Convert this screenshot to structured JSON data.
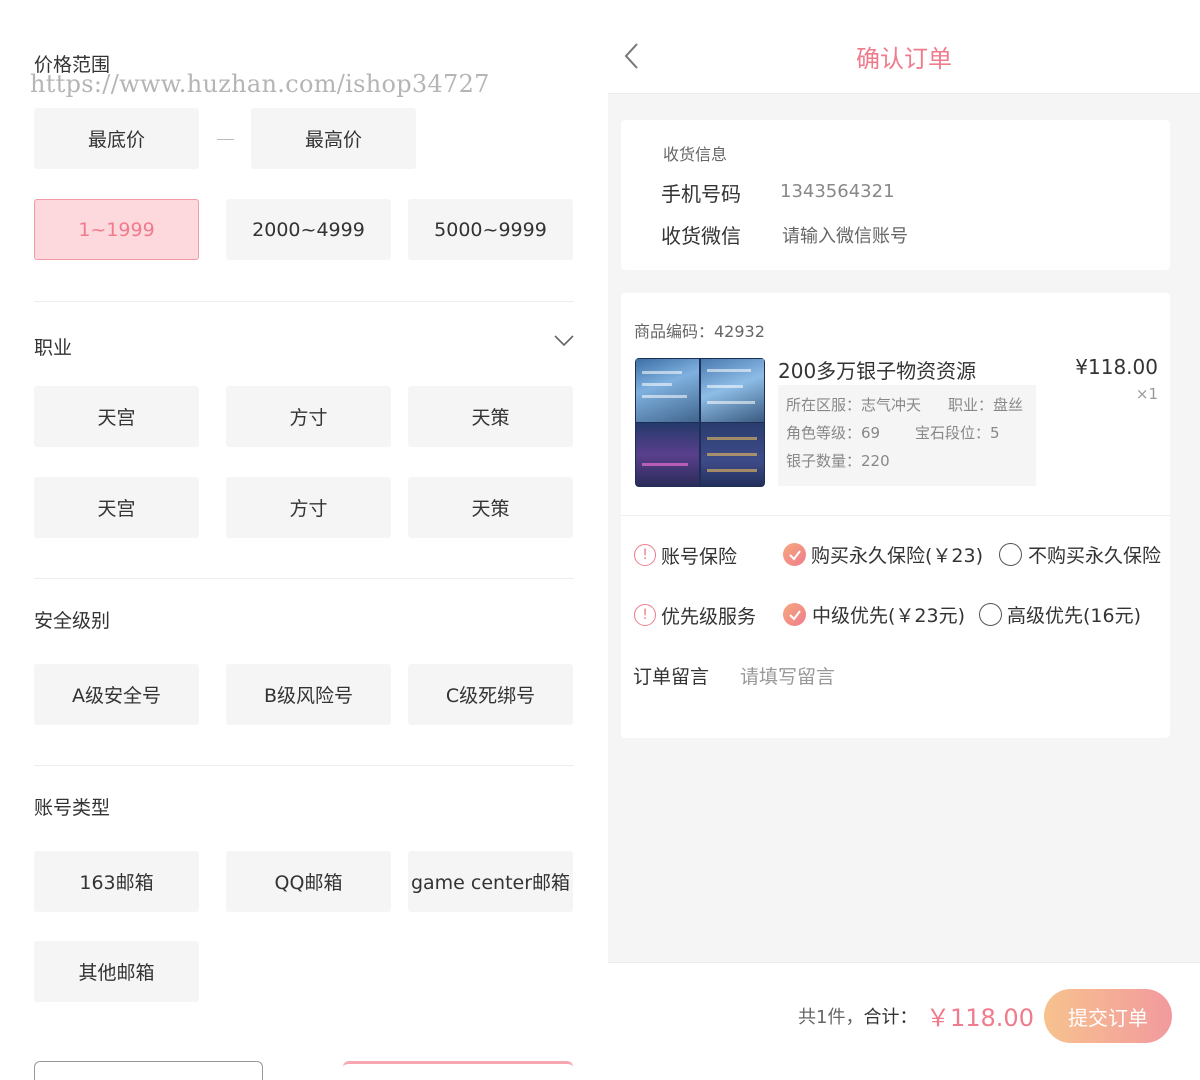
{
  "watermark": "https://www.huzhan.com/ishop34727",
  "filter": {
    "price": {
      "title": "价格范围",
      "min_placeholder": "最底价",
      "max_placeholder": "最高价",
      "ranges": [
        "1~1999",
        "2000~4999",
        "5000~9999"
      ],
      "selected": "1~1999"
    },
    "profession": {
      "title": "职业",
      "options": [
        "天宫",
        "方寸",
        "天策",
        "天宫",
        "方寸",
        "天策"
      ]
    },
    "security": {
      "title": "安全级别",
      "options": [
        "A级安全号",
        "B级风险号",
        "C级死绑号"
      ]
    },
    "account_type": {
      "title": "账号类型",
      "options": [
        "163邮箱",
        "QQ邮箱",
        "game center邮箱",
        "其他邮箱"
      ]
    }
  },
  "order": {
    "title": "确认订单",
    "shipping": {
      "section_label": "收货信息",
      "phone_label": "手机号码",
      "phone_value": "1343564321",
      "wechat_label": "收货微信",
      "wechat_placeholder": "请输入微信账号"
    },
    "goods": {
      "code_label": "商品编码：42932",
      "name": "200多万银子物资资源",
      "price": "¥118.00",
      "quantity": "×1",
      "attrs": {
        "server": "所在区服：志气冲天",
        "profession": "职业：盘丝",
        "level": "角色等级：69",
        "gem": "宝石段位：5",
        "silver": "银子数量：220"
      }
    },
    "insurance": {
      "label": "账号保险",
      "option_on": "购买永久保险(￥23)",
      "option_off": "不购买永久保险"
    },
    "priority": {
      "label": "优先级服务",
      "option_on": "中级优先(￥23元)",
      "option_off": "高级优先(16元)"
    },
    "note": {
      "label": "订单留言",
      "placeholder": "请填写留言"
    },
    "footer": {
      "count_text": "共1件，",
      "total_label": "合计：",
      "total_amount": "￥118.00",
      "submit_label": "提交订单"
    }
  },
  "colors": {
    "accent": "#f07b8c",
    "selected_bg": "#fdd8dc",
    "option_bg": "#f5f5f5",
    "submit_gradient_start": "#f7c28e",
    "submit_gradient_end": "#f29a9e"
  }
}
